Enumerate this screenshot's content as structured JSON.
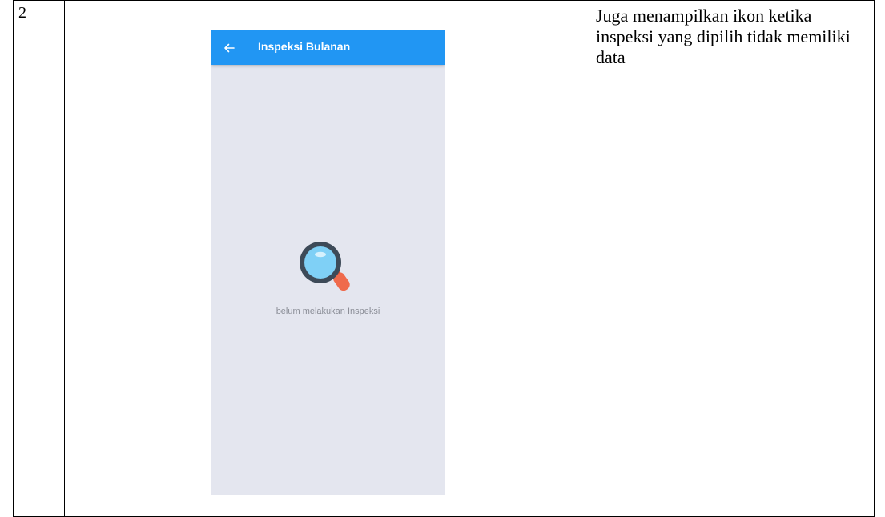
{
  "row": {
    "number": "2",
    "description": "Juga menampilkan ikon ketika inspeksi yang dipilih tidak memiliki data"
  },
  "phone": {
    "appbar": {
      "title": "Inspeksi Bulanan",
      "back_icon": "arrow-left-icon",
      "color": "#2196f3"
    },
    "empty_state": {
      "icon": "magnifier-icon",
      "text": "belum melakukan Inspeksi"
    },
    "background": "#e4e6ef"
  }
}
